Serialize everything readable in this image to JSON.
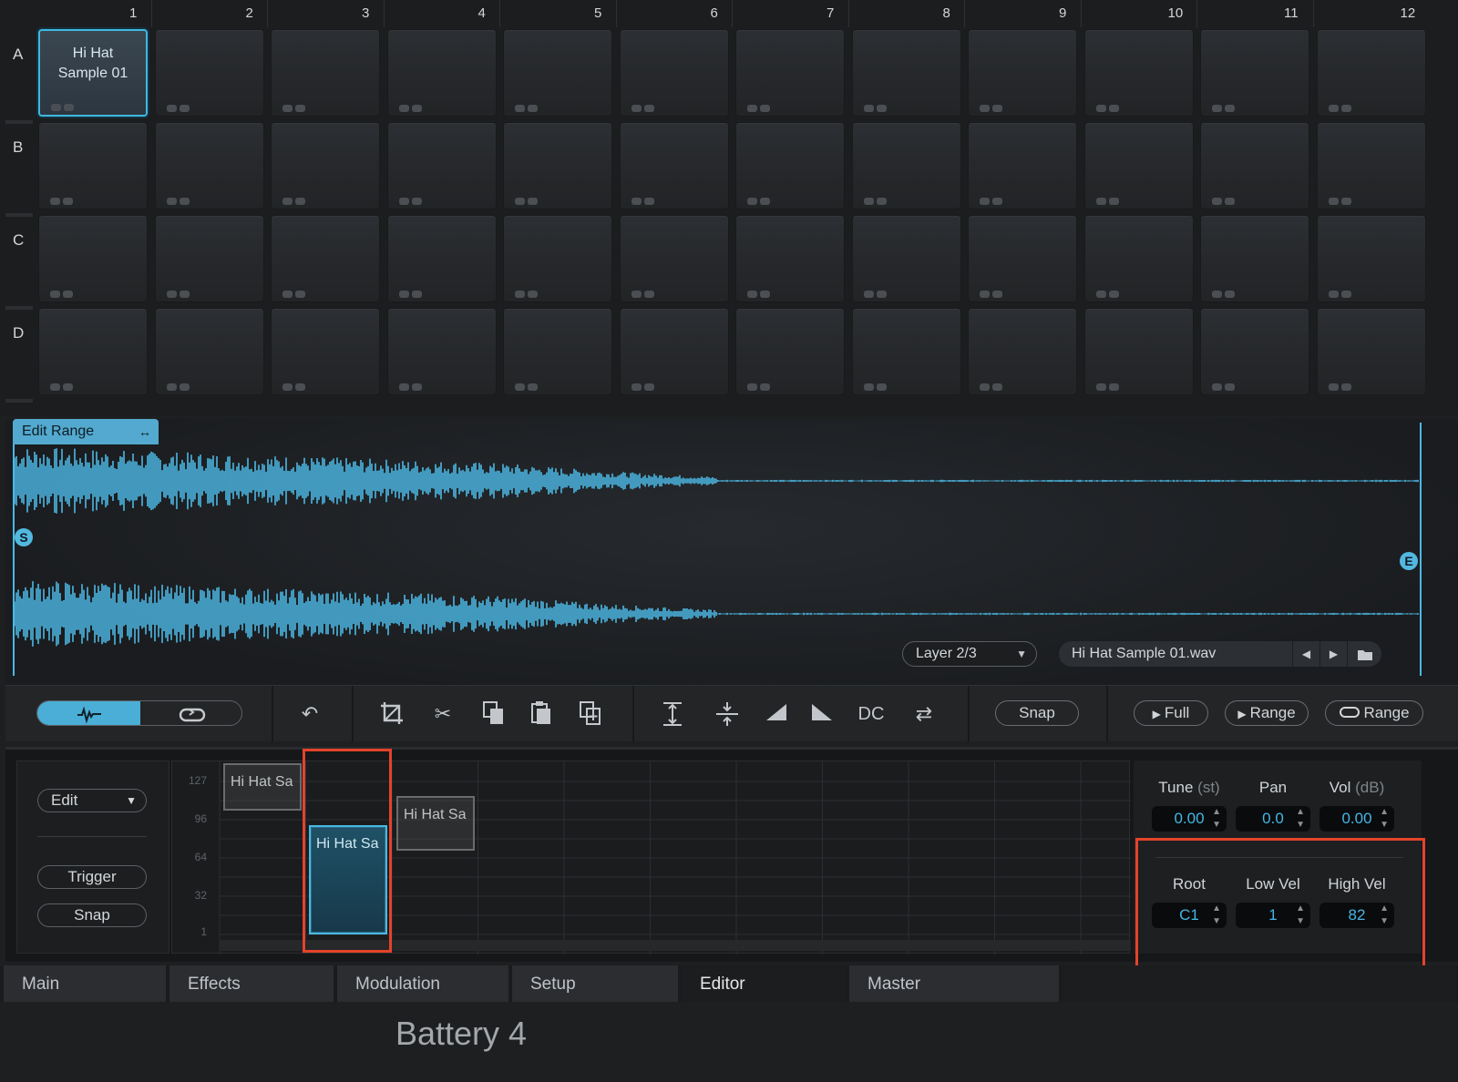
{
  "grid": {
    "columns": [
      "1",
      "2",
      "3",
      "4",
      "5",
      "6",
      "7",
      "8",
      "9",
      "10",
      "11",
      "12"
    ],
    "rows": [
      "A",
      "B",
      "C",
      "D"
    ],
    "loaded_cell": {
      "row": "A",
      "column": "1",
      "line1": "Hi Hat",
      "line2": "Sample 01"
    }
  },
  "waveform": {
    "edit_range_label": "Edit Range",
    "edit_range_icon": "↔",
    "start_marker": "S",
    "end_marker": "E",
    "layer_select": "Layer 2/3",
    "file_name": "Hi Hat Sample 01.wav",
    "waveform_color": "#4cb8e4"
  },
  "toolbar": {
    "view_toggle": [
      "waveform-icon",
      "loop-icon"
    ],
    "dc_label": "DC",
    "snap_label": "Snap",
    "play_full_label": "Full",
    "play_range_label": "Range",
    "loop_range_label": "Range"
  },
  "mapping": {
    "mode_select": "Edit",
    "trigger_label": "Trigger",
    "snap_label": "Snap",
    "velocity_ticks": [
      "127",
      "96",
      "64",
      "32",
      "1"
    ],
    "zones": [
      {
        "label": "Hi Hat Sa",
        "selected": false
      },
      {
        "label": "Hi Hat Sa",
        "selected": true
      },
      {
        "label": "Hi Hat Sa",
        "selected": false
      }
    ],
    "params_top": [
      {
        "label": "Tune",
        "unit": "(st)",
        "value": "0.00"
      },
      {
        "label": "Pan",
        "unit": "",
        "value": "0.0"
      },
      {
        "label": "Vol",
        "unit": "(dB)",
        "value": "0.00"
      }
    ],
    "params_bottom": [
      {
        "label": "Root",
        "value": "C1"
      },
      {
        "label": "Low Vel",
        "value": "1"
      },
      {
        "label": "High Vel",
        "value": "82"
      }
    ],
    "highlight_color": "#e4432b"
  },
  "tabs": [
    "Main",
    "Effects",
    "Modulation",
    "Setup",
    "Editor",
    "Master"
  ],
  "active_tab": "Editor",
  "caption": "Battery 4"
}
